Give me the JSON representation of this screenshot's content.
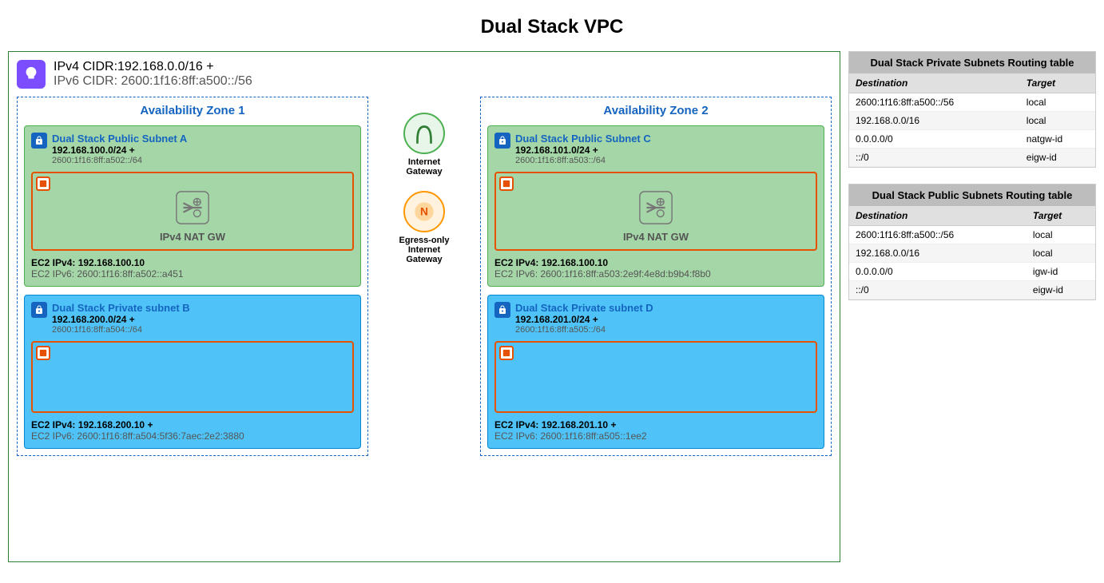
{
  "page": {
    "title": "Dual Stack VPC"
  },
  "vpc": {
    "ipv4_cidr_label": "IPv4 CIDR:192.168.0.0/16 +",
    "ipv6_cidr_label": "IPv6 CIDR: 2600:1f16:8ff:a500::/56"
  },
  "az1": {
    "title": "Availability Zone 1",
    "public_subnet": {
      "name": "Dual Stack Public Subnet A",
      "ipv4": "192.168.100.0/24 +",
      "ipv6": "2600:1f16:8ff:a502::/64",
      "nat_gw_label": "IPv4 NAT GW",
      "ec2_ipv4": "EC2 IPv4: 192.168.100.10",
      "ec2_ipv6": "EC2 IPv6: 2600:1f16:8ff:a502::a451"
    },
    "private_subnet": {
      "name": "Dual Stack Private subnet B",
      "ipv4": "192.168.200.0/24 +",
      "ipv6": "2600:1f16:8ff:a504::/64",
      "ec2_ipv4": "EC2 IPv4: 192.168.200.10 +",
      "ec2_ipv6": "EC2 IPv6: 2600:1f16:8ff:a504:5f36:7aec:2e2:3880"
    }
  },
  "az2": {
    "title": "Availability Zone 2",
    "public_subnet": {
      "name": "Dual Stack Public Subnet C",
      "ipv4": "192.168.101.0/24 +",
      "ipv6": "2600:1f16:8ff:a503::/64",
      "nat_gw_label": "IPv4 NAT GW",
      "ec2_ipv4": "EC2 IPv4: 192.168.100.10",
      "ec2_ipv6": "EC2 IPv6: 2600:1f16:8ff:a503:2e9f:4e8d:b9b4:f8b0"
    },
    "private_subnet": {
      "name": "Dual Stack Private subnet D",
      "ipv4": "192.168.201.0/24 +",
      "ipv6": "2600:1f16:8ff:a505::/64",
      "ec2_ipv4": "EC2 IPv4: 192.168.201.10 +",
      "ec2_ipv6": "EC2 IPv6: 2600:1f16:8ff:a505::1ee2"
    }
  },
  "gateways": {
    "igw_label": "Internet\nGateway",
    "eigw_label": "Egress-only\nInternet\nGateway"
  },
  "routing": {
    "private_table": {
      "title": "Dual Stack Private Subnets Routing table",
      "col_dest": "Destination",
      "col_target": "Target",
      "rows": [
        {
          "dest": "2600:1f16:8ff:a500::/56",
          "target": "local"
        },
        {
          "dest": "192.168.0.0/16",
          "target": "local"
        },
        {
          "dest": "0.0.0.0/0",
          "target": "natgw-id"
        },
        {
          "dest": "::/0",
          "target": "eigw-id"
        }
      ]
    },
    "public_table": {
      "title": "Dual Stack Public Subnets Routing table",
      "col_dest": "Destination",
      "col_target": "Target",
      "rows": [
        {
          "dest": "2600:1f16:8ff:a500::/56",
          "target": "local"
        },
        {
          "dest": "192.168.0.0/16",
          "target": "local"
        },
        {
          "dest": "0.0.0.0/0",
          "target": "igw-id"
        },
        {
          "dest": "::/0",
          "target": "eigw-id"
        }
      ]
    }
  }
}
